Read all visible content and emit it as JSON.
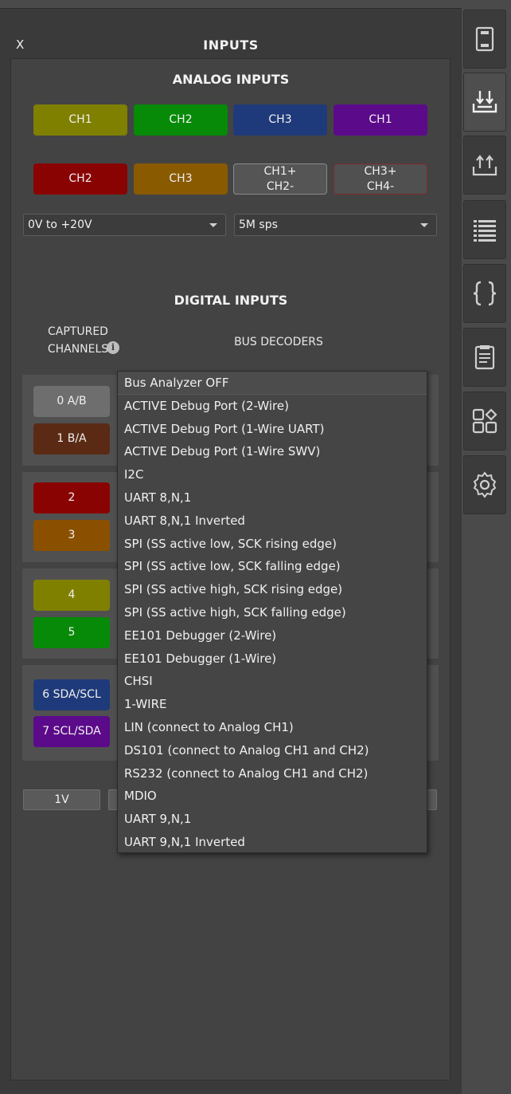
{
  "panel": {
    "close_label": "X",
    "title": "INPUTS"
  },
  "analog": {
    "title": "ANALOG INPUTS",
    "channels": [
      {
        "label": "CH1",
        "color": "#808000"
      },
      {
        "label": "CH2",
        "color": "#078a07"
      },
      {
        "label": "CH3",
        "color": "#1f3a7a"
      },
      {
        "label": "CH1",
        "color": "#5b0a8a"
      },
      {
        "label": "CH2",
        "color": "#8a0303"
      },
      {
        "label": "CH3",
        "color": "#8a5a00"
      },
      {
        "label": "CH1+\nCH2-",
        "color": "#555555"
      },
      {
        "label": "CH3+\nCH4-",
        "color": "#505050"
      }
    ],
    "range_select": "0V to +20V",
    "rate_select": "5M sps"
  },
  "digital": {
    "title": "DIGITAL INPUTS",
    "captured_label": "CAPTURED\nCHANNELS",
    "bus_decoders_label": "BUS DECODERS",
    "channels": [
      {
        "label": "0 A/B",
        "color": "#6e6e6e"
      },
      {
        "label": "1 B/A",
        "color": "#5a2a14"
      },
      {
        "label": "2",
        "color": "#8a0303"
      },
      {
        "label": "3",
        "color": "#8a5000"
      },
      {
        "label": "4",
        "color": "#808000"
      },
      {
        "label": "5",
        "color": "#078a07"
      },
      {
        "label": "6 SDA/SCL",
        "color": "#1f3a7a"
      },
      {
        "label": "7 SCL/SDA",
        "color": "#5b0a8a"
      }
    ],
    "voltage_button": "1V"
  },
  "bus_dropdown": {
    "options": [
      "Bus Analyzer OFF",
      "ACTIVE Debug Port (2-Wire)",
      "ACTIVE Debug Port (1-Wire UART)",
      "ACTIVE Debug Port (1-Wire SWV)",
      "I2C",
      "UART 8,N,1",
      "UART 8,N,1 Inverted",
      "SPI (SS active low, SCK rising edge)",
      "SPI (SS active low, SCK falling edge)",
      "SPI (SS active high, SCK rising edge)",
      "SPI (SS active high, SCK falling edge)",
      "EE101 Debugger (2-Wire)",
      "EE101 Debugger (1-Wire)",
      "CHSI",
      "1-WIRE",
      "LIN (connect to Analog CH1)",
      "DS101 (connect to Analog CH1 and CH2)",
      "RS232 (connect to Analog CH1 and CH2)",
      "MDIO",
      "UART 9,N,1",
      "UART 9,N,1 Inverted"
    ]
  },
  "sidebar": {
    "items": [
      {
        "icon": "device-icon"
      },
      {
        "icon": "import-icon",
        "active": true
      },
      {
        "icon": "export-icon"
      },
      {
        "icon": "list-icon"
      },
      {
        "icon": "braces-icon"
      },
      {
        "icon": "notes-icon"
      },
      {
        "icon": "widgets-icon"
      },
      {
        "icon": "gear-icon"
      }
    ]
  }
}
